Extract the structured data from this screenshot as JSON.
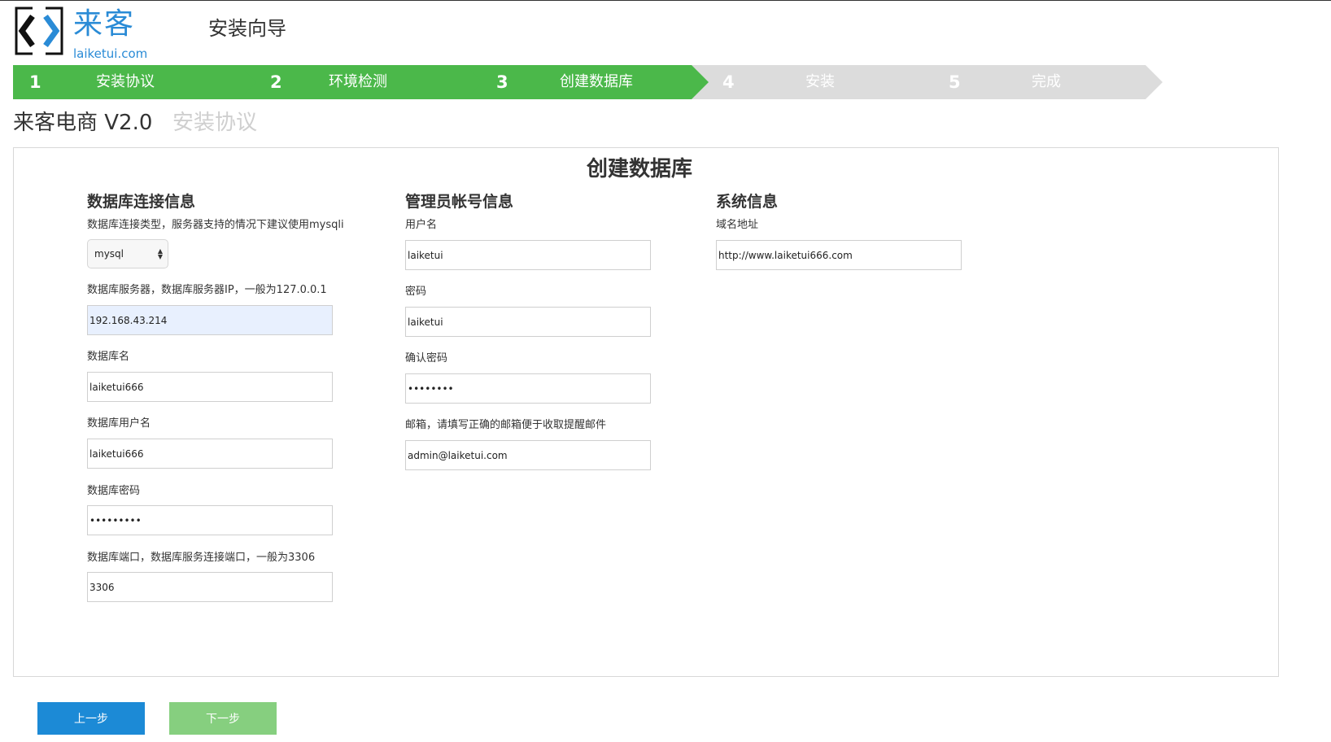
{
  "header": {
    "logo_cn": "来客",
    "logo_en": "laiketui.com",
    "wizard_title": "安装向导"
  },
  "colors": {
    "step_active": "#4bb84a",
    "step_inactive": "#dcdcdc",
    "brand_blue": "#2a8bd6",
    "button_prev": "#1c8ad6",
    "button_next": "#86cf7f"
  },
  "steps": [
    {
      "num": "1",
      "label": "安装协议",
      "active": true
    },
    {
      "num": "2",
      "label": "环境检测",
      "active": true
    },
    {
      "num": "3",
      "label": "创建数据库",
      "active": true
    },
    {
      "num": "4",
      "label": "安装",
      "active": false
    },
    {
      "num": "5",
      "label": "完成",
      "active": false
    }
  ],
  "subtitle": {
    "app_name": "来客电商 V2.0",
    "page_name": "安装协议"
  },
  "panel": {
    "title": "创建数据库"
  },
  "db": {
    "section_title": "数据库连接信息",
    "type_label": "数据库连接类型，服务器支持的情况下建议使用mysqli",
    "type_value": "mysql",
    "server_label": "数据库服务器，数据库服务器IP，一般为127.0.0.1",
    "server_value": "192.168.43.214",
    "name_label": "数据库名",
    "name_value": "laiketui666",
    "user_label": "数据库用户名",
    "user_value": "laiketui666",
    "password_label": "数据库密码",
    "password_value": "•••••••••",
    "port_label": "数据库端口，数据库服务连接端口，一般为3306",
    "port_value": "3306"
  },
  "admin": {
    "section_title": "管理员帐号信息",
    "username_label": "用户名",
    "username_value": "laiketui",
    "password_label": "密码",
    "password_value": "laiketui",
    "confirm_label": "确认密码",
    "confirm_value": "••••••••",
    "email_label": "邮箱，请填写正确的邮箱便于收取提醒邮件",
    "email_value": "admin@laiketui.com"
  },
  "system": {
    "section_title": "系统信息",
    "domain_label": "域名地址",
    "domain_value": "http://www.laiketui666.com"
  },
  "buttons": {
    "prev": "上一步",
    "next": "下一步"
  }
}
